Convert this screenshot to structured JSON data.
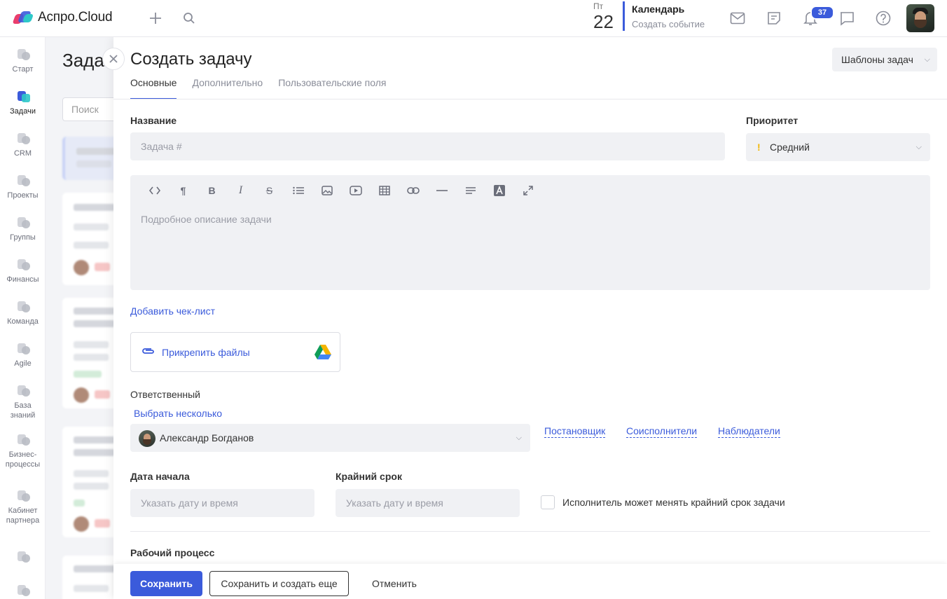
{
  "header": {
    "brand": "Аспро.Cloud",
    "date": {
      "weekday": "Пт",
      "day": "22"
    },
    "calendar": {
      "title": "Календарь",
      "subtitle": "Создать событие"
    },
    "notifications_count": "37"
  },
  "sidebar": {
    "items": [
      {
        "label": "Старт"
      },
      {
        "label": "Задачи"
      },
      {
        "label": "CRM"
      },
      {
        "label": "Проекты"
      },
      {
        "label": "Группы"
      },
      {
        "label": "Финансы"
      },
      {
        "label": "Команда"
      },
      {
        "label": "Agile"
      },
      {
        "label": "База знаний"
      },
      {
        "label": "Бизнес-процессы"
      },
      {
        "label": "Кабинет партнера"
      }
    ]
  },
  "background": {
    "title": "Зада",
    "search_placeholder": "Поиск"
  },
  "panel": {
    "title": "Создать задачу",
    "templates_button": "Шаблоны задач",
    "tabs": [
      {
        "label": "Основные"
      },
      {
        "label": "Дополнительно"
      },
      {
        "label": "Пользовательские поля"
      }
    ],
    "name_label": "Название",
    "name_placeholder": "Задача #",
    "priority_label": "Приоритет",
    "priority_value": "Средний",
    "description_placeholder": "Подробное описание задачи",
    "add_checklist": "Добавить чек-лист",
    "attach_files": "Прикрепить файлы",
    "responsible_label": "Ответственный",
    "select_multiple": "Выбрать несколько",
    "responsible_value": "Александр Богданов",
    "role_links": [
      "Постановщик",
      "Соисполнители",
      "Наблюдатели"
    ],
    "start_date_label": "Дата начала",
    "start_date_placeholder": "Указать дату и время",
    "deadline_label": "Крайний срок",
    "deadline_placeholder": "Указать дату и время",
    "deadline_checkbox_label": "Исполнитель может менять крайний срок задачи",
    "workflow_label": "Рабочий процесс"
  },
  "footer": {
    "save": "Сохранить",
    "save_and_new": "Сохранить и создать еще",
    "cancel": "Отменить"
  },
  "colors": {
    "accent": "#3b5bdb",
    "field_bg": "#f0f1f4"
  }
}
